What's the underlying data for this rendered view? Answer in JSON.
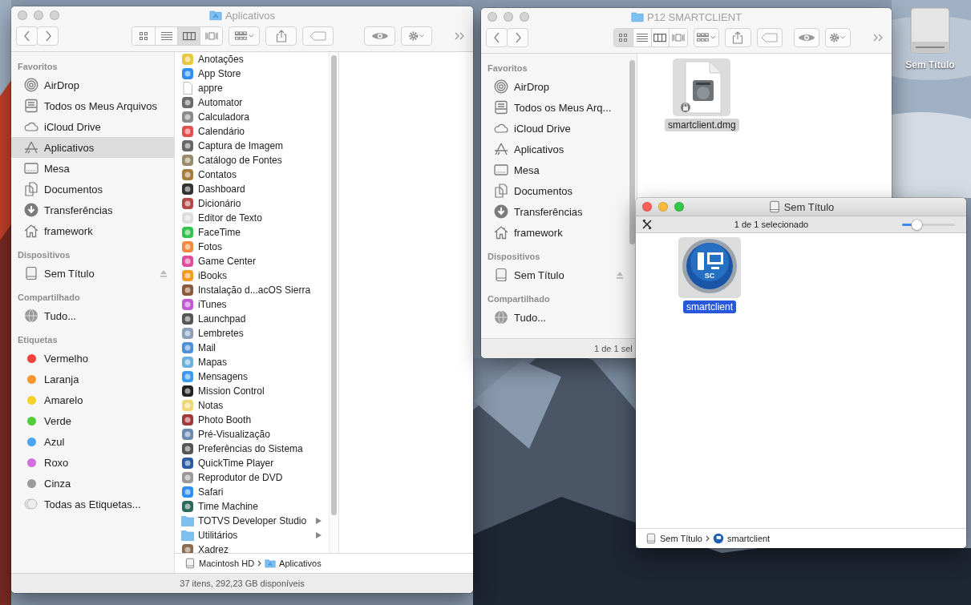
{
  "desktop": {
    "items": [
      {
        "label": "Sem Título"
      }
    ]
  },
  "applications_window": {
    "title": "Aplicativos",
    "kind": "apps-folder",
    "active": false,
    "views": [
      {
        "kind": "icons",
        "selected": false
      },
      {
        "kind": "list",
        "selected": false
      },
      {
        "kind": "columns",
        "selected": true
      },
      {
        "kind": "gallery",
        "selected": false
      }
    ],
    "sidebar": [
      {
        "heading": "Favoritos",
        "items": [
          {
            "kind": "airdrop",
            "label": "AirDrop",
            "selected": false
          },
          {
            "kind": "files",
            "label": "Todos os Meus Arquivos",
            "selected": false
          },
          {
            "kind": "cloud",
            "label": "iCloud Drive",
            "selected": false
          },
          {
            "kind": "apps",
            "label": "Aplicativos",
            "selected": true
          },
          {
            "kind": "desktop",
            "label": "Mesa",
            "selected": false
          },
          {
            "kind": "documents",
            "label": "Documentos",
            "selected": false
          },
          {
            "kind": "downloads",
            "label": "Transferências",
            "selected": false
          },
          {
            "kind": "home",
            "label": "framework",
            "selected": false
          }
        ]
      },
      {
        "heading": "Dispositivos",
        "items": [
          {
            "kind": "disk",
            "label": "Sem Título",
            "ejectable": true,
            "selected": false
          }
        ]
      },
      {
        "heading": "Compartilhado",
        "items": [
          {
            "kind": "network",
            "label": "Tudo...",
            "selected": false
          }
        ]
      },
      {
        "heading": "Etiquetas",
        "items": [
          {
            "kind": "tag",
            "label": "Vermelho",
            "color": "#f2403d",
            "selected": false
          },
          {
            "kind": "tag",
            "label": "Laranja",
            "color": "#f7962e",
            "selected": false
          },
          {
            "kind": "tag",
            "label": "Amarelo",
            "color": "#f5d02a",
            "selected": false
          },
          {
            "kind": "tag",
            "label": "Verde",
            "color": "#52cc3c",
            "selected": false
          },
          {
            "kind": "tag",
            "label": "Azul",
            "color": "#4aa6f4",
            "selected": false
          },
          {
            "kind": "tag",
            "label": "Roxo",
            "color": "#d26ee0",
            "selected": false
          },
          {
            "kind": "tag",
            "label": "Cinza",
            "color": "#9a9a9a",
            "selected": false
          },
          {
            "kind": "all-tags",
            "label": "Todas as Etiquetas...",
            "selected": false
          }
        ]
      }
    ],
    "column": [
      {
        "kind": "app",
        "label": "Anotações",
        "selected": false
      },
      {
        "kind": "app",
        "label": "App Store",
        "selected": false
      },
      {
        "kind": "document",
        "label": "appre",
        "selected": false
      },
      {
        "kind": "app",
        "label": "Automator",
        "selected": false
      },
      {
        "kind": "app",
        "label": "Calculadora",
        "selected": false
      },
      {
        "kind": "app",
        "label": "Calendário",
        "selected": false
      },
      {
        "kind": "app",
        "label": "Captura de Imagem",
        "selected": false
      },
      {
        "kind": "app",
        "label": "Catálogo de Fontes",
        "selected": false
      },
      {
        "kind": "app",
        "label": "Contatos",
        "selected": false
      },
      {
        "kind": "app",
        "label": "Dashboard",
        "selected": false
      },
      {
        "kind": "app",
        "label": "Dicionário",
        "selected": false
      },
      {
        "kind": "app",
        "label": "Editor de Texto",
        "selected": false
      },
      {
        "kind": "app",
        "label": "FaceTime",
        "selected": false
      },
      {
        "kind": "app",
        "label": "Fotos",
        "selected": false
      },
      {
        "kind": "app",
        "label": "Game Center",
        "selected": false
      },
      {
        "kind": "app",
        "label": "iBooks",
        "selected": false
      },
      {
        "kind": "app",
        "label": "Instalação d...acOS Sierra",
        "selected": false
      },
      {
        "kind": "app",
        "label": "iTunes",
        "selected": false
      },
      {
        "kind": "app",
        "label": "Launchpad",
        "selected": false
      },
      {
        "kind": "app",
        "label": "Lembretes",
        "selected": false
      },
      {
        "kind": "app",
        "label": "Mail",
        "selected": false
      },
      {
        "kind": "app",
        "label": "Mapas",
        "selected": false
      },
      {
        "kind": "app",
        "label": "Mensagens",
        "selected": false
      },
      {
        "kind": "app",
        "label": "Mission Control",
        "selected": false
      },
      {
        "kind": "app",
        "label": "Notas",
        "selected": false
      },
      {
        "kind": "app",
        "label": "Photo Booth",
        "selected": false
      },
      {
        "kind": "app",
        "label": "Pré-Visualização",
        "selected": false
      },
      {
        "kind": "app",
        "label": "Preferências do Sistema",
        "selected": false
      },
      {
        "kind": "app",
        "label": "QuickTime Player",
        "selected": false
      },
      {
        "kind": "app",
        "label": "Reprodutor de DVD",
        "selected": false
      },
      {
        "kind": "app",
        "label": "Safari",
        "selected": false
      },
      {
        "kind": "app",
        "label": "Time Machine",
        "selected": false
      },
      {
        "kind": "folder",
        "label": "TOTVS Developer Studio",
        "selected": false
      },
      {
        "kind": "folder",
        "label": "Utilitários",
        "selected": false
      },
      {
        "kind": "app",
        "label": "Xadrez",
        "selected": false
      }
    ],
    "path": [
      {
        "kind": "disk",
        "label": "Macintosh HD"
      },
      {
        "kind": "apps-folder",
        "label": "Aplicativos"
      }
    ],
    "status": "37 itens, 292,23 GB disponíveis"
  },
  "folder_window": {
    "title": "P12 SMARTCLIENT",
    "kind": "folder",
    "active": false,
    "views": [
      {
        "kind": "icons",
        "selected": true
      },
      {
        "kind": "list",
        "selected": false
      },
      {
        "kind": "columns",
        "selected": false
      },
      {
        "kind": "gallery",
        "selected": false
      }
    ],
    "sidebar": [
      {
        "heading": "Favoritos",
        "items": [
          {
            "kind": "airdrop",
            "label": "AirDrop",
            "selected": false
          },
          {
            "kind": "files",
            "label": "Todos os Meus Arq...",
            "selected": false
          },
          {
            "kind": "cloud",
            "label": "iCloud Drive",
            "selected": false
          },
          {
            "kind": "apps",
            "label": "Aplicativos",
            "selected": false
          },
          {
            "kind": "desktop",
            "label": "Mesa",
            "selected": false
          },
          {
            "kind": "documents",
            "label": "Documentos",
            "selected": false
          },
          {
            "kind": "downloads",
            "label": "Transferências",
            "selected": false
          },
          {
            "kind": "home",
            "label": "framework",
            "selected": false
          }
        ]
      },
      {
        "heading": "Dispositivos",
        "items": [
          {
            "kind": "disk",
            "label": "Sem Título",
            "ejectable": true,
            "selected": false
          }
        ]
      },
      {
        "heading": "Compartilhado",
        "items": [
          {
            "kind": "network",
            "label": "Tudo...",
            "selected": false
          }
        ]
      }
    ],
    "files": [
      {
        "kind": "disk-image",
        "name": "smartclient.dmg",
        "locked": true,
        "selected": true
      }
    ],
    "status": "1 de 1 sel"
  },
  "volume_window": {
    "title": "Sem Título",
    "kind": "disk",
    "active": true,
    "info": "1 de 1 selecionado",
    "icon_size": {
      "level": 0.27
    },
    "files": [
      {
        "kind": "app",
        "name": "smartclient",
        "icon_label": "SC",
        "selected": true
      }
    ],
    "path": [
      {
        "kind": "disk",
        "label": "Sem Título"
      },
      {
        "kind": "app",
        "label": "smartclient"
      }
    ]
  }
}
